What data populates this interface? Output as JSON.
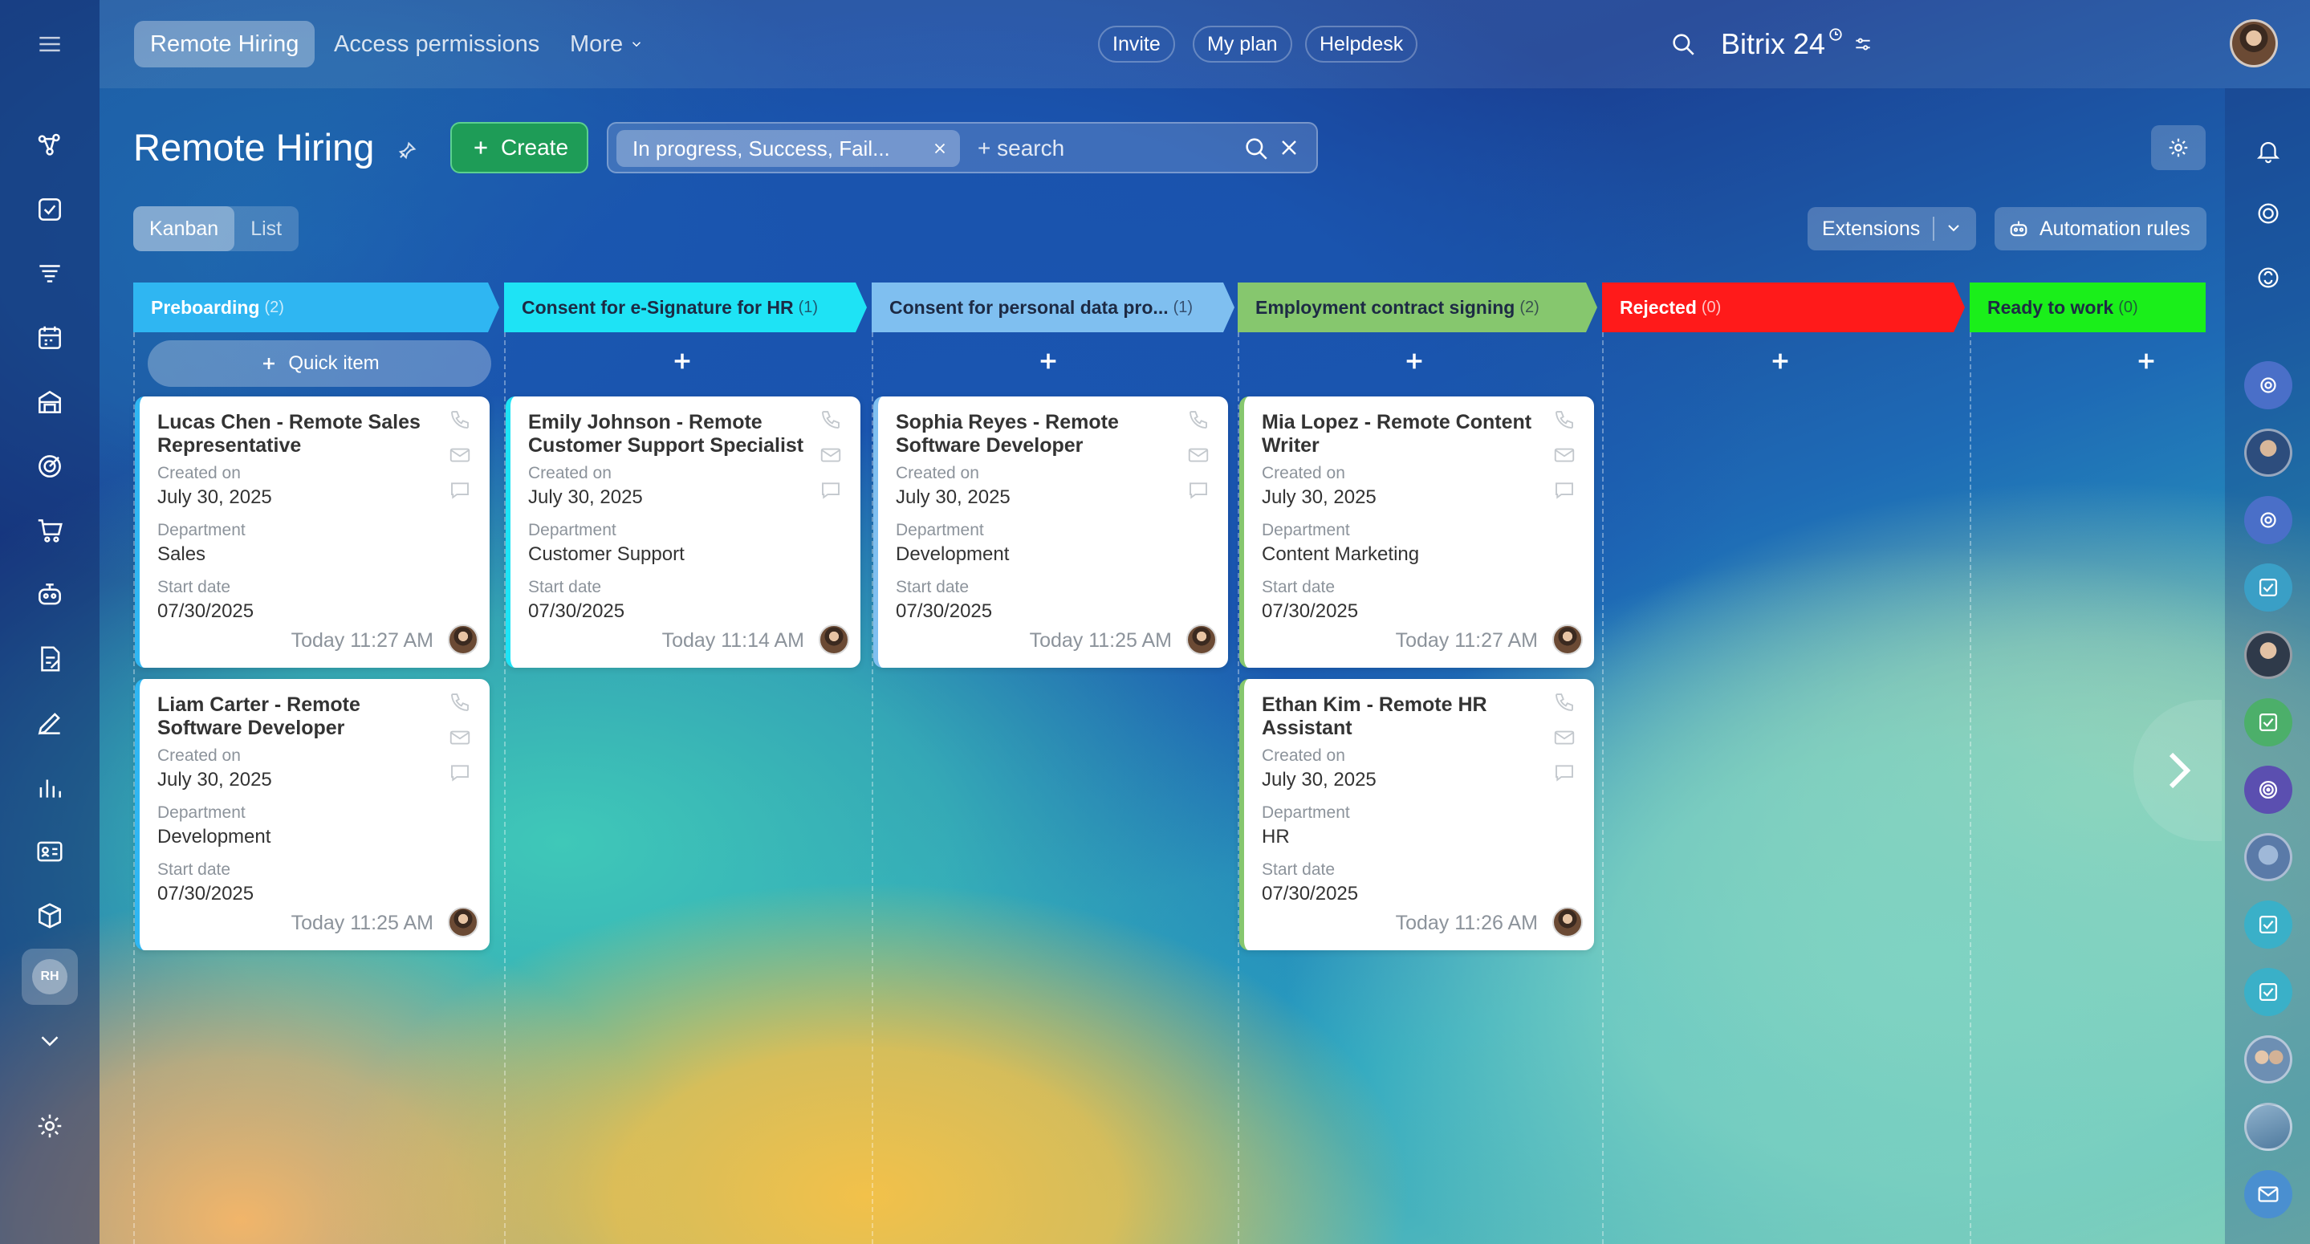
{
  "top_nav": {
    "tabs": [
      {
        "label": "Remote Hiring",
        "active": true
      },
      {
        "label": "Access permissions",
        "active": false
      },
      {
        "label": "More",
        "active": false
      }
    ],
    "brand": "Bitrix 24",
    "invite_label": "Invite",
    "my_plan_label": "My plan",
    "helpdesk_label": "Helpdesk"
  },
  "header": {
    "title": "Remote Hiring",
    "create_label": "Create",
    "filter_chip": "In progress, Success, Fail...",
    "search_placeholder": "+ search"
  },
  "toolbar": {
    "views": [
      {
        "label": "Kanban",
        "active": true
      },
      {
        "label": "List",
        "active": false
      }
    ],
    "extensions_label": "Extensions",
    "automation_label": "Automation rules"
  },
  "left_rail": {
    "badge": "RH"
  },
  "kanban": {
    "quick_item_label": "Quick item",
    "columns": [
      {
        "name": "Preboarding",
        "count": "(2)",
        "color": "#2fb6f2",
        "cards": [
          {
            "title": "Lucas Chen - Remote Sales Representative",
            "created_label": "Created on",
            "created": "July 30, 2025",
            "dept_label": "Department",
            "dept": "Sales",
            "start_label": "Start date",
            "start": "07/30/2025",
            "time": "Today 11:27 AM"
          },
          {
            "title": "Liam Carter - Remote Software Developer",
            "created_label": "Created on",
            "created": "July 30, 2025",
            "dept_label": "Department",
            "dept": "Development",
            "start_label": "Start date",
            "start": "07/30/2025",
            "time": "Today 11:25 AM"
          }
        ]
      },
      {
        "name": "Consent for e-Signature for HR",
        "count": "(1)",
        "color": "#1ee3f5",
        "cards": [
          {
            "title": "Emily Johnson - Remote Customer Support Specialist",
            "created_label": "Created on",
            "created": "July 30, 2025",
            "dept_label": "Department",
            "dept": "Customer Support",
            "start_label": "Start date",
            "start": "07/30/2025",
            "time": "Today 11:14 AM"
          }
        ]
      },
      {
        "name": "Consent for personal data pro...",
        "count": "(1)",
        "color": "#7fbff0",
        "cards": [
          {
            "title": "Sophia Reyes - Remote Software Developer",
            "created_label": "Created on",
            "created": "July 30, 2025",
            "dept_label": "Department",
            "dept": "Development",
            "start_label": "Start date",
            "start": "07/30/2025",
            "time": "Today 11:25 AM"
          }
        ]
      },
      {
        "name": "Employment contract signing",
        "count": "(2)",
        "color": "#86c76e",
        "cards": [
          {
            "title": "Mia Lopez - Remote Content Writer",
            "created_label": "Created on",
            "created": "July 30, 2025",
            "dept_label": "Department",
            "dept": "Content Marketing",
            "start_label": "Start date",
            "start": "07/30/2025",
            "time": "Today 11:27 AM"
          },
          {
            "title": "Ethan Kim - Remote HR Assistant",
            "created_label": "Created on",
            "created": "July 30, 2025",
            "dept_label": "Department",
            "dept": "HR",
            "start_label": "Start date",
            "start": "07/30/2025",
            "time": "Today 11:26 AM"
          }
        ]
      },
      {
        "name": "Rejected",
        "count": "(0)",
        "color": "#ff1a1a",
        "cards": []
      },
      {
        "name": "Ready to work",
        "count": "(0)",
        "color": "#1aef1a",
        "cards": []
      }
    ]
  }
}
